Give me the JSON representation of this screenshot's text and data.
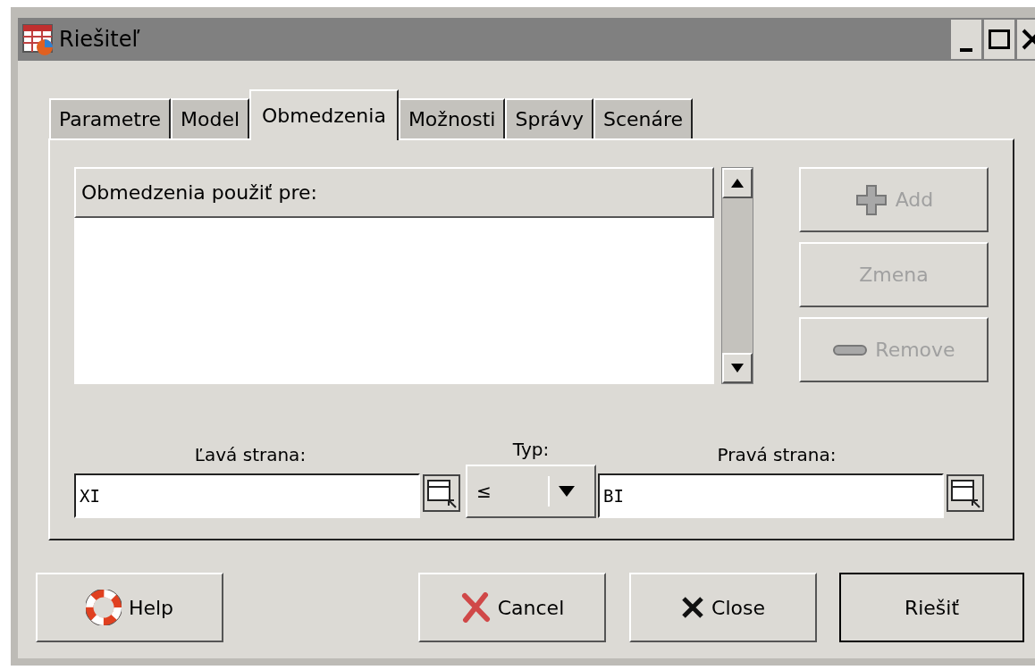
{
  "window": {
    "title": "Riešiteľ"
  },
  "tabs": [
    {
      "label": "Parametre",
      "selected": false
    },
    {
      "label": "Model",
      "selected": false
    },
    {
      "label": "Obmedzenia",
      "selected": true
    },
    {
      "label": "Možnosti",
      "selected": false
    },
    {
      "label": "Správy",
      "selected": false
    },
    {
      "label": "Scenáre",
      "selected": false
    }
  ],
  "constraints_list": {
    "header": "Obmedzenia použiť pre:"
  },
  "side_buttons": [
    {
      "kind": "add",
      "label": "Add",
      "disabled": true
    },
    {
      "kind": "plain",
      "label": "Zmena",
      "disabled": true
    },
    {
      "kind": "remove",
      "label": "Remove",
      "disabled": true
    }
  ],
  "left_side": {
    "label": "Ľavá strana:",
    "value": "XI"
  },
  "type": {
    "label": "Typ:",
    "value": "≤"
  },
  "right_side": {
    "label": "Pravá strana:",
    "value": "BI"
  },
  "footer_buttons": [
    {
      "kind": "help",
      "label": "Help",
      "default": false
    },
    {
      "kind": "cancel",
      "label": "Cancel",
      "default": false
    },
    {
      "kind": "close",
      "label": "Close",
      "default": false
    },
    {
      "kind": "plain",
      "label": "Riešiť",
      "default": true
    }
  ]
}
